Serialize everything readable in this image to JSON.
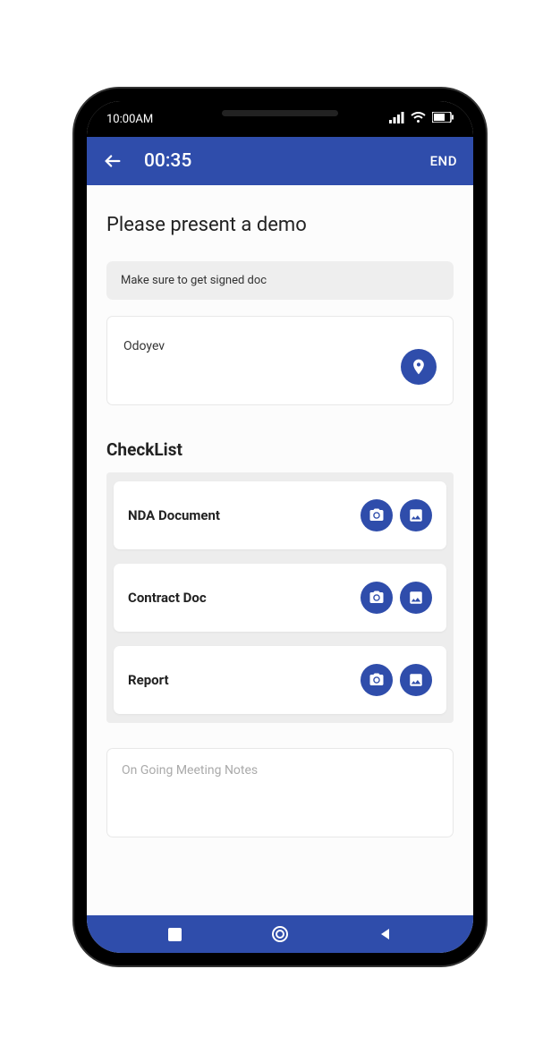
{
  "statusBar": {
    "time": "10:00AM"
  },
  "appBar": {
    "timer": "00:35",
    "endLabel": "END"
  },
  "page": {
    "title": "Please present a demo",
    "noteText": "Make sure to get signed doc",
    "locationName": "Odoyev"
  },
  "checklist": {
    "title": "CheckList",
    "items": [
      {
        "label": "NDA Document"
      },
      {
        "label": "Contract Doc"
      },
      {
        "label": "Report"
      }
    ]
  },
  "notes": {
    "placeholder": "On Going Meeting Notes"
  },
  "colors": {
    "primary": "#2f4dab"
  }
}
